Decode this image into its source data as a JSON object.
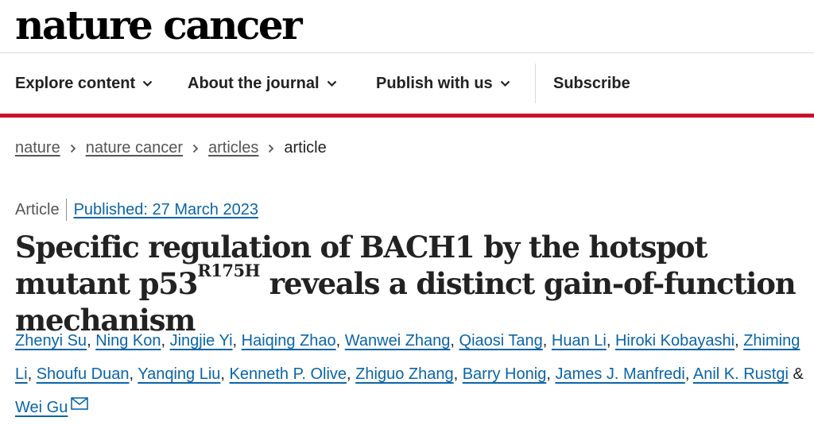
{
  "brand": {
    "logo": "nature cancer"
  },
  "nav": {
    "items": [
      {
        "label": "Explore content",
        "icon": "chevron-down-icon"
      },
      {
        "label": "About the journal",
        "icon": "chevron-down-icon"
      },
      {
        "label": "Publish with us",
        "icon": "chevron-down-icon"
      }
    ],
    "subscribe": "Subscribe"
  },
  "colors": {
    "accent": "#c8102e",
    "link": "#0b65a8"
  },
  "breadcrumb": {
    "items": [
      "nature",
      "nature cancer",
      "articles"
    ],
    "current": "article"
  },
  "article": {
    "type": "Article",
    "published": "Published: 27 March 2023",
    "title_part1": "Specific regulation of BACH1 by the hotspot mutant p53",
    "title_sup": "R175H",
    "title_part2": " reveals a distinct gain-of-function mechanism",
    "authors": [
      "Zhenyi Su",
      "Ning Kon",
      "Jingjie Yi",
      "Haiqing Zhao",
      "Wanwei Zhang",
      "Qiaosi Tang",
      "Huan Li",
      "Hiroki Kobayashi",
      "Zhiming Li",
      "Shoufu Duan",
      "Yanqing Liu",
      "Kenneth P. Olive",
      "Zhiguo Zhang",
      "Barry Honig",
      "James J. Manfredi",
      "Anil K. Rustgi",
      "Wei Gu"
    ],
    "author_sep": ", ",
    "author_last_sep": " & ",
    "corresponding_icon": "mail-icon"
  }
}
